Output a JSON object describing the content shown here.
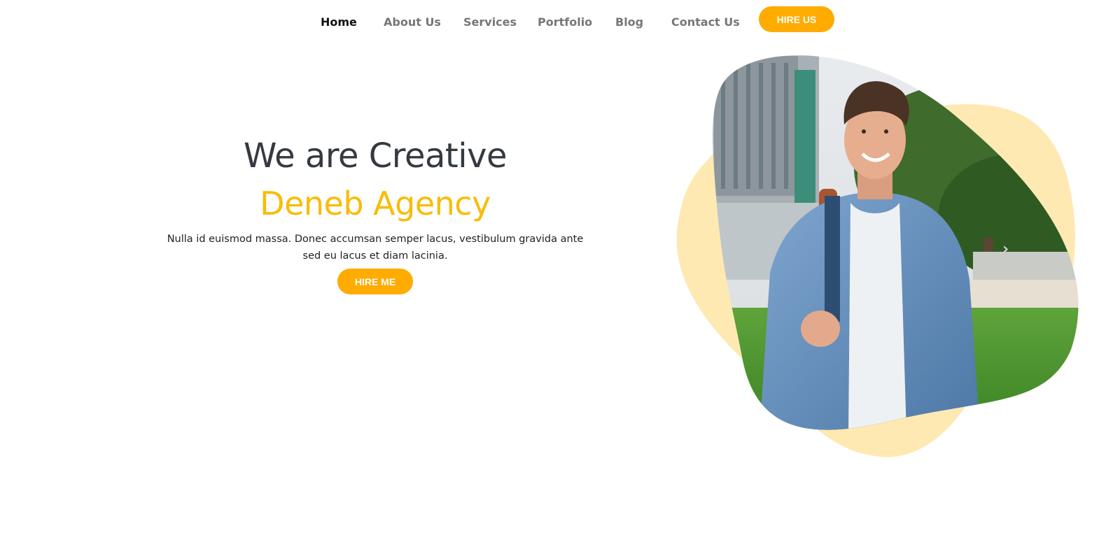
{
  "nav": {
    "items": [
      {
        "label": "Home",
        "active": true
      },
      {
        "label": "About Us",
        "active": false
      },
      {
        "label": "Services",
        "active": false
      },
      {
        "label": "Portfolio",
        "active": false
      },
      {
        "label": "Blog",
        "active": false
      },
      {
        "label": "Contact Us",
        "active": false
      }
    ],
    "cta_label": "HIRE US"
  },
  "hero": {
    "title": "We are Creative",
    "subtitle": "Deneb Agency",
    "description": "Nulla id euismod massa. Donec accumsan semper lacus, vestibulum gravida ante sed eu lacus et diam lacinia.",
    "cta_label": "HIRE ME"
  },
  "visual": {
    "image_subject": "smiling man in denim jacket with backpack, outdoors",
    "next_icon": "chevron-right-icon",
    "glyph_next": "›"
  },
  "colors": {
    "accent": "#FFAB00",
    "subtitle": "#F9BC08",
    "blob": "#FFE9B2",
    "heading": "#343a40"
  }
}
